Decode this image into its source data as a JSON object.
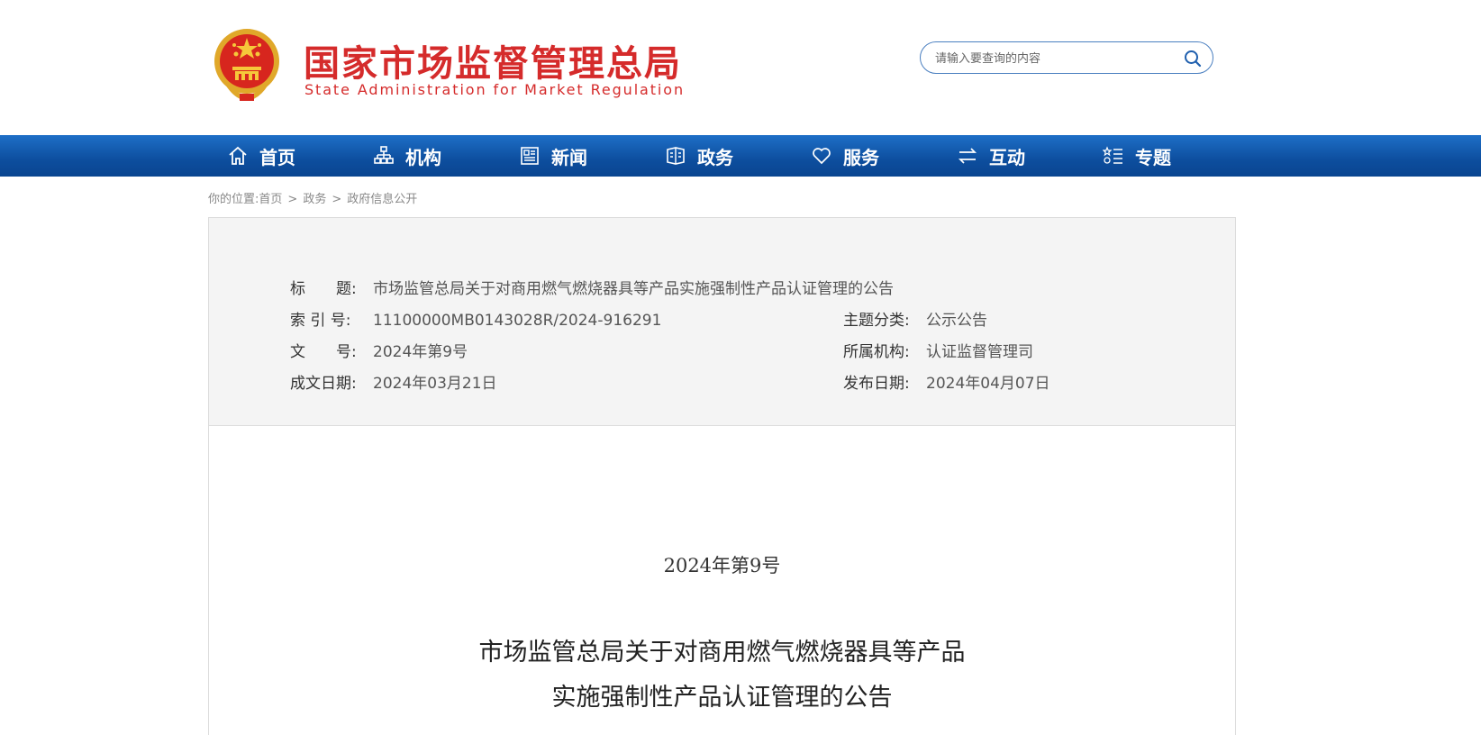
{
  "header": {
    "site_title_cn": "国家市场监督管理总局",
    "site_title_en": "State Administration for Market Regulation",
    "search_placeholder": "请输入要查询的内容",
    "brand_color": "#d52b2b"
  },
  "nav": {
    "items": [
      {
        "label": "首页",
        "icon": "home-icon"
      },
      {
        "label": "机构",
        "icon": "org-chart-icon"
      },
      {
        "label": "新闻",
        "icon": "newspaper-icon"
      },
      {
        "label": "政务",
        "icon": "policy-icon"
      },
      {
        "label": "服务",
        "icon": "heart-icon"
      },
      {
        "label": "互动",
        "icon": "exchange-icon"
      },
      {
        "label": "专题",
        "icon": "topic-list-icon"
      }
    ],
    "bg_color": "#0d4e9e"
  },
  "breadcrumb": {
    "prefix": "你的位置:",
    "items": [
      "首页",
      "政务",
      "政府信息公开"
    ],
    "separator": ">"
  },
  "info": {
    "title_label": "标　　题:",
    "title_value": "市场监管总局关于对商用燃气燃烧器具等产品实施强制性产品认证管理的公告",
    "index_label": "索 引 号:",
    "index_value": "11100000MB0143028R/2024-916291",
    "topic_label": "主题分类:",
    "topic_value": "公示公告",
    "doc_no_label": "文　　号:",
    "doc_no_value": "2024年第9号",
    "org_label": "所属机构:",
    "org_value": "认证监督管理司",
    "created_label": "成文日期:",
    "created_value": "2024年03月21日",
    "published_label": "发布日期:",
    "published_value": "2024年04月07日"
  },
  "article": {
    "doc_number": "2024年第9号",
    "title_line1": "市场监管总局关于对商用燃气燃烧器具等产品",
    "title_line2": "实施强制性产品认证管理的公告"
  }
}
